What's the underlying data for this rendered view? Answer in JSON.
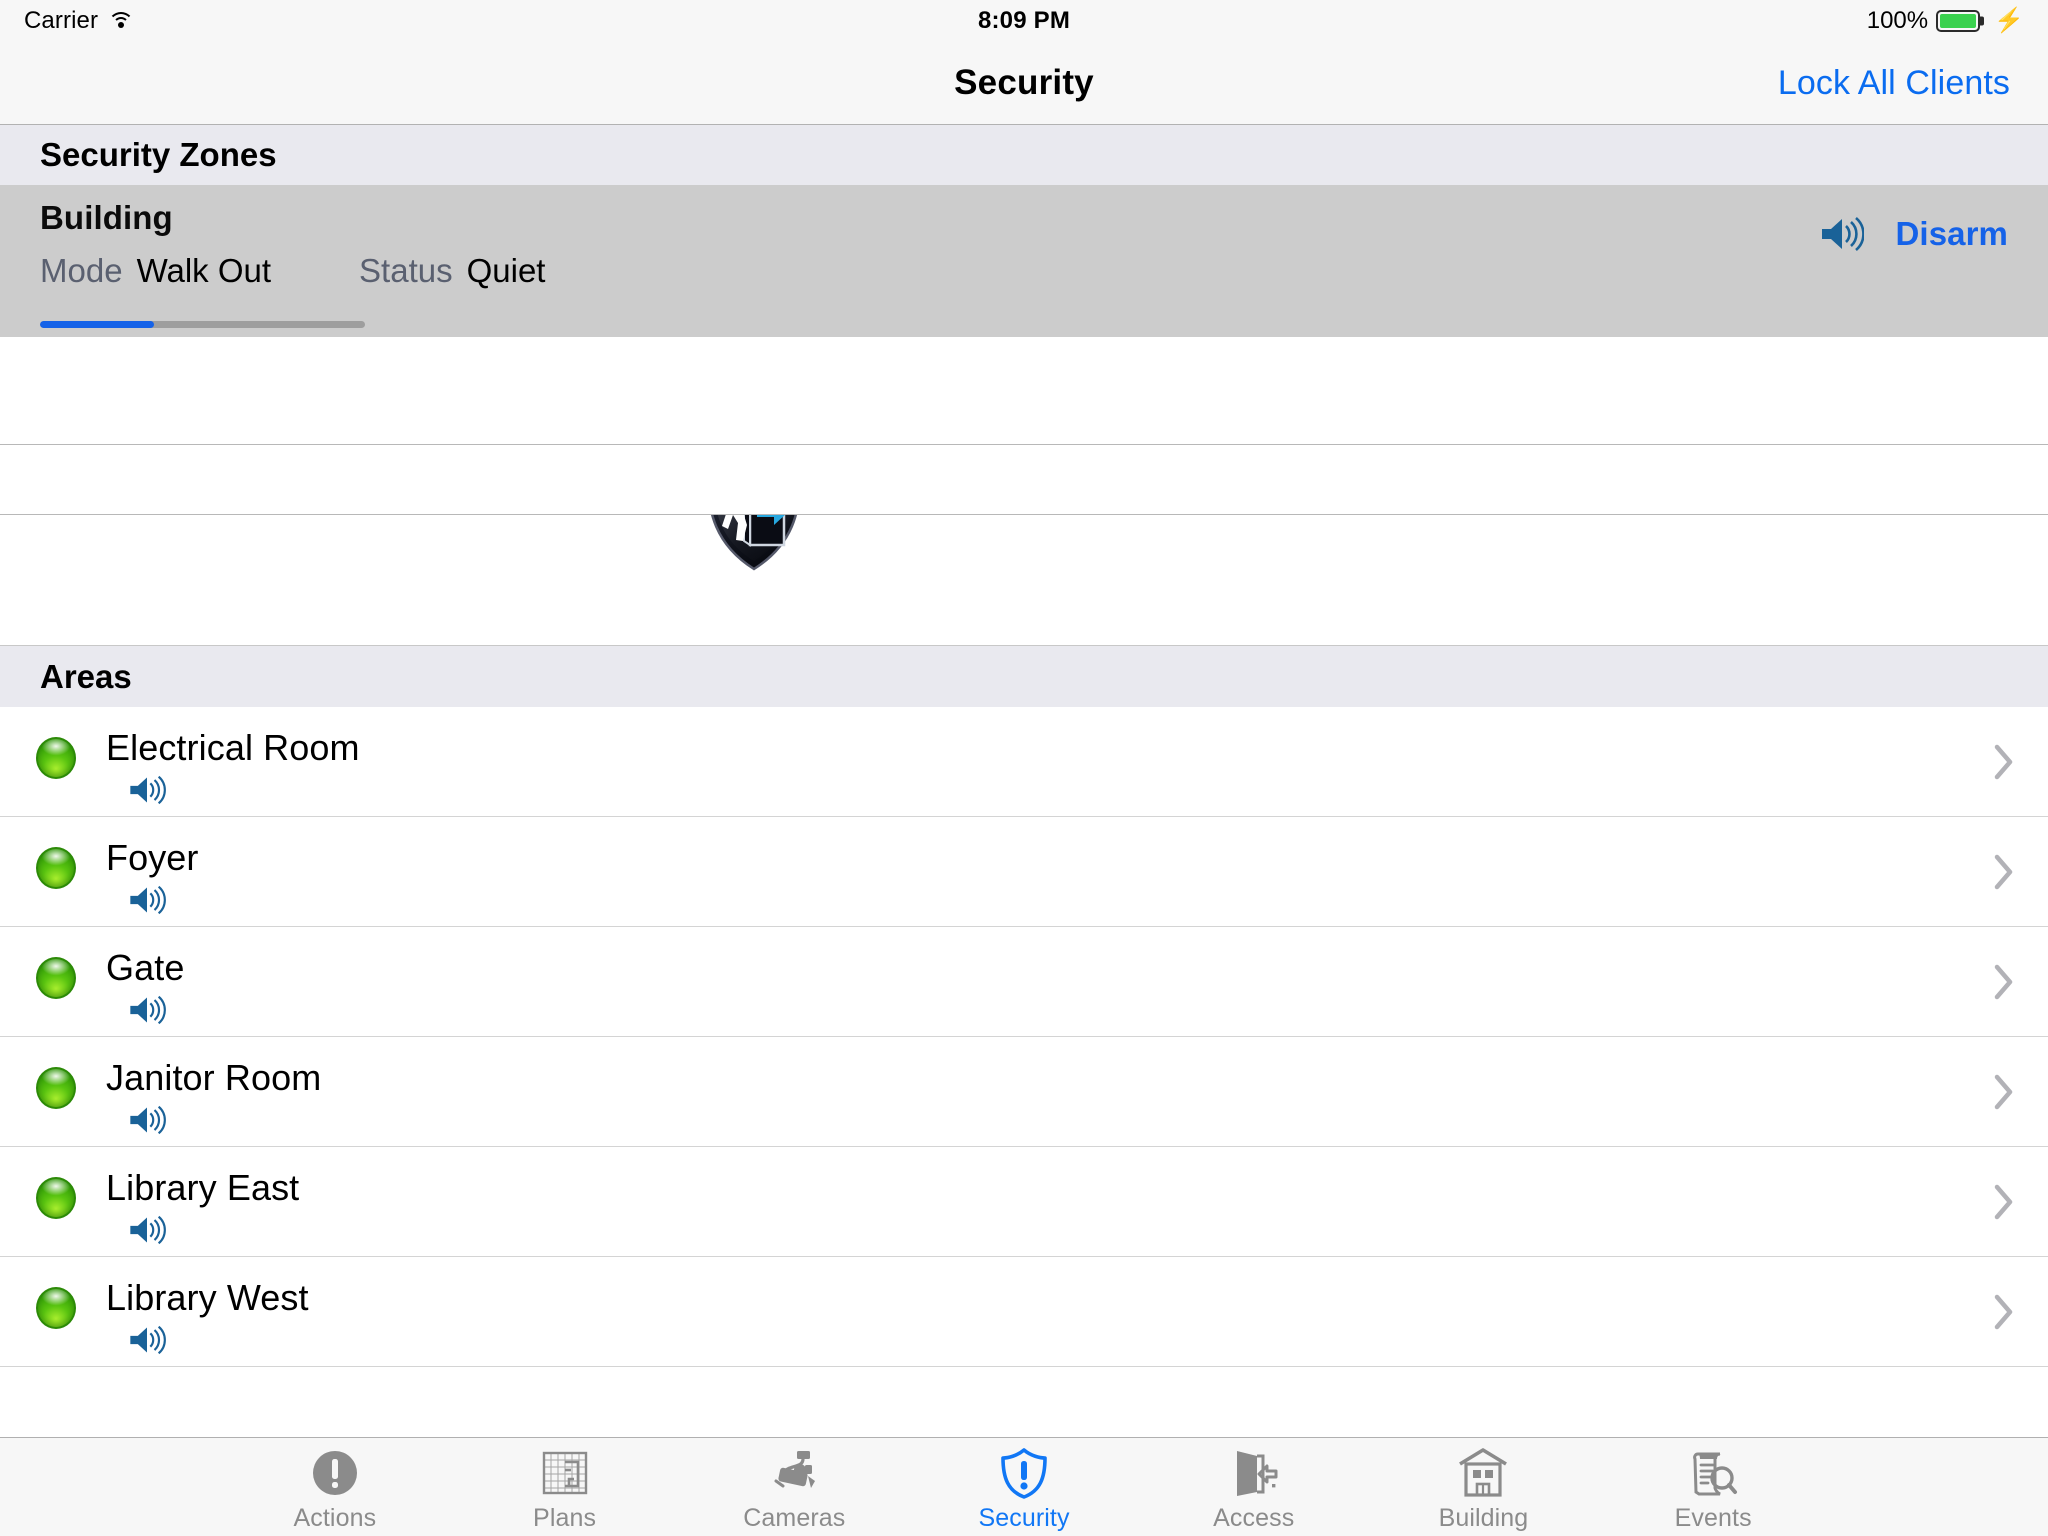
{
  "status_bar": {
    "carrier": "Carrier",
    "wifi_icon": "wifi-icon",
    "time": "8:09 PM",
    "battery_percent": "100%",
    "battery_level": 100,
    "charging_icon": "lightning-bolt-icon"
  },
  "nav": {
    "title": "Security",
    "action_label": "Lock All Clients",
    "action_color": "#0a6cf0"
  },
  "zones_section": {
    "header": "Security Zones",
    "zone": {
      "name": "Building",
      "mode_label": "Mode",
      "mode_value": "Walk Out",
      "status_label": "Status",
      "status_value": "Quiet",
      "progress_percent": 35,
      "progress_fill_color": "#1562e8",
      "progress_track_color": "#9e9e9e",
      "shield_icon": "walk-out-shield-icon",
      "speaker_icon": "speaker-icon",
      "disarm_label": "Disarm",
      "disarm_color": "#1562e8",
      "row_background": "#cccccc"
    }
  },
  "areas_section": {
    "header": "Areas",
    "rows": [
      {
        "name": "Electrical Room",
        "led": "green",
        "speaker_icon": "speaker-icon",
        "chevron_icon": "chevron-right-icon"
      },
      {
        "name": "Foyer",
        "led": "green",
        "speaker_icon": "speaker-icon",
        "chevron_icon": "chevron-right-icon"
      },
      {
        "name": "Gate",
        "led": "green",
        "speaker_icon": "speaker-icon",
        "chevron_icon": "chevron-right-icon"
      },
      {
        "name": "Janitor Room",
        "led": "green",
        "speaker_icon": "speaker-icon",
        "chevron_icon": "chevron-right-icon"
      },
      {
        "name": "Library East",
        "led": "green",
        "speaker_icon": "speaker-icon",
        "chevron_icon": "chevron-right-icon"
      },
      {
        "name": "Library West",
        "led": "green",
        "speaker_icon": "speaker-icon",
        "chevron_icon": "chevron-right-icon"
      }
    ],
    "led_color": "#4fc010"
  },
  "tab_bar": {
    "active_index": 3,
    "active_color": "#1177f5",
    "inactive_color": "#8b8b8b",
    "tabs": [
      {
        "label": "Actions",
        "icon": "alert-circle-icon"
      },
      {
        "label": "Plans",
        "icon": "floorplan-grid-icon"
      },
      {
        "label": "Cameras",
        "icon": "security-camera-icon"
      },
      {
        "label": "Security",
        "icon": "shield-alert-icon"
      },
      {
        "label": "Access",
        "icon": "door-arrow-icon"
      },
      {
        "label": "Building",
        "icon": "building-icon"
      },
      {
        "label": "Events",
        "icon": "document-search-icon"
      }
    ]
  }
}
